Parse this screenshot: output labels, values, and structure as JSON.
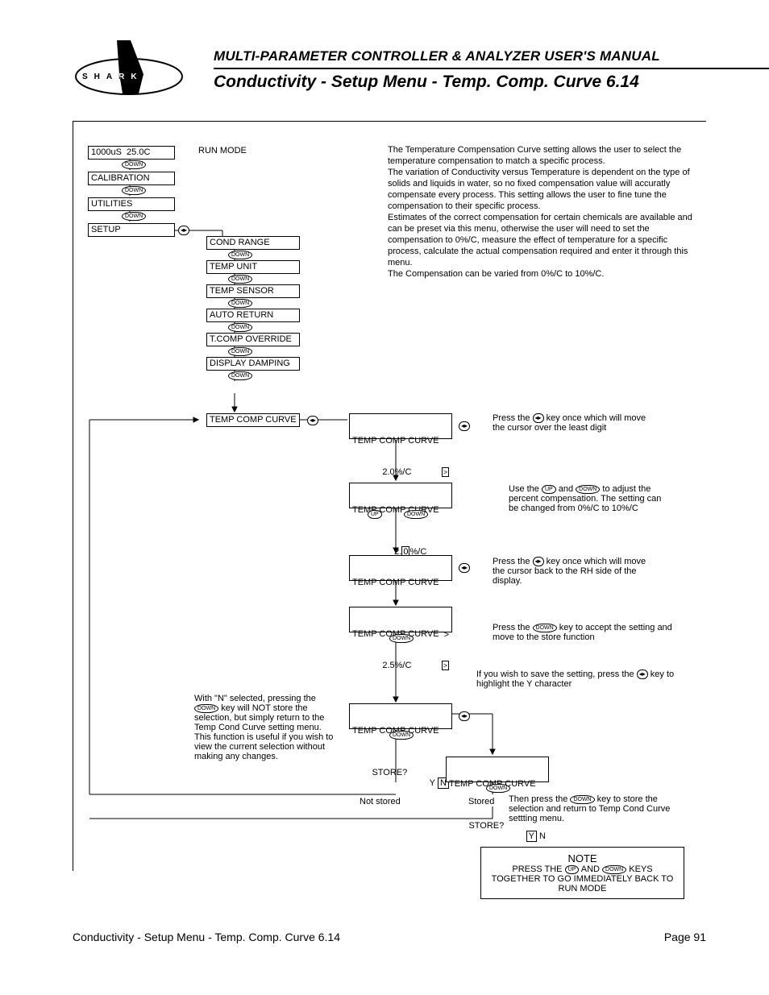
{
  "header": {
    "manual_title": "MULTI-PARAMETER CONTROLLER & ANALYZER USER'S MANUAL",
    "section_title": "Conductivity - Setup Menu - Temp. Comp. Curve 6.14",
    "logo_letters": [
      "S",
      "H",
      "A",
      "R",
      "K"
    ]
  },
  "keys": {
    "down": "DOWN",
    "up": "UP",
    "arrows": "◂▸"
  },
  "menu": {
    "run_value": "1000uS  25.0C",
    "run_label": "RUN MODE",
    "items": [
      "CALIBRATION",
      "UTILITIES",
      "SETUP"
    ],
    "setup_sub": [
      "COND RANGE",
      "TEMP UNIT",
      "TEMP SENSOR",
      "AUTO RETURN",
      "T.COMP OVERRIDE",
      "DISPLAY DAMPING",
      "TEMP COMP CURVE"
    ]
  },
  "tcc": {
    "title": "TEMP COMP CURVE",
    "val1": "2.0%/C",
    "val2_pre": "2.",
    "val2_digit": "0",
    "val2_post": "%/C",
    "val3_pre": "2.",
    "val3_digit": "5",
    "val3_post": "%/C",
    "val4": "2.5%/C",
    "store_prompt": "STORE?",
    "y": "Y",
    "n": "N",
    "gt": ">",
    "not_stored": "Not stored",
    "stored": "Stored"
  },
  "desc": {
    "p1": "The Temperature Compensation Curve setting allows the user to select the temperature compensation to match a specific process.",
    "p2": "The variation of Conductivity versus Temperature is dependent on the type of solids and liquids in water, so no fixed compensation value will accuratly compensate every process. This setting allows the user to fine tune the compensation to their specific process.",
    "p3": "Estimates of the correct compensation for certain chemicals are available and can be preset via this menu, otherwise the user will need to set the compensation to 0%/C, measure the effect of temperature for a specific process, calculate the actual compensation required and enter it through this menu.",
    "p4": "The Compensation can be varied from 0%/C to 10%/C."
  },
  "steps": {
    "s1a": "Press the ",
    "s1b": " key once which will move the cursor over the least digit",
    "s2a": "Use the ",
    "s2b": " and ",
    "s2c": " to adjust the percent compensation. The setting can be changed from 0%/C to 10%/C",
    "s3a": "Press the ",
    "s3b": " key once which will move the cursor back to the RH side of the display.",
    "s4a": "Press the ",
    "s4b": " key to accept the setting and move to the store function",
    "s5a": "If you wish to save the setting, press the ",
    "s5b": " key to highlight the Y character",
    "s6a": "With \"N\" selected, pressing the ",
    "s6b": " key will NOT store the selection, but simply return to the Temp Cond Curve setting menu. This function is useful if you wish to view the current selection without making any changes.",
    "s7a": "Then press the ",
    "s7b": " key to store the selection and return to Temp Cond Curve settting menu."
  },
  "note": {
    "title": "NOTE",
    "l1a": "PRESS THE ",
    "l1b": " AND ",
    "l1c": " KEYS",
    "l2": "TOGETHER TO GO IMMEDIATELY BACK TO",
    "l3": "RUN MODE"
  },
  "footer": {
    "left": "Conductivity - Setup Menu - Temp. Comp. Curve 6.14",
    "right": "Page 91"
  }
}
